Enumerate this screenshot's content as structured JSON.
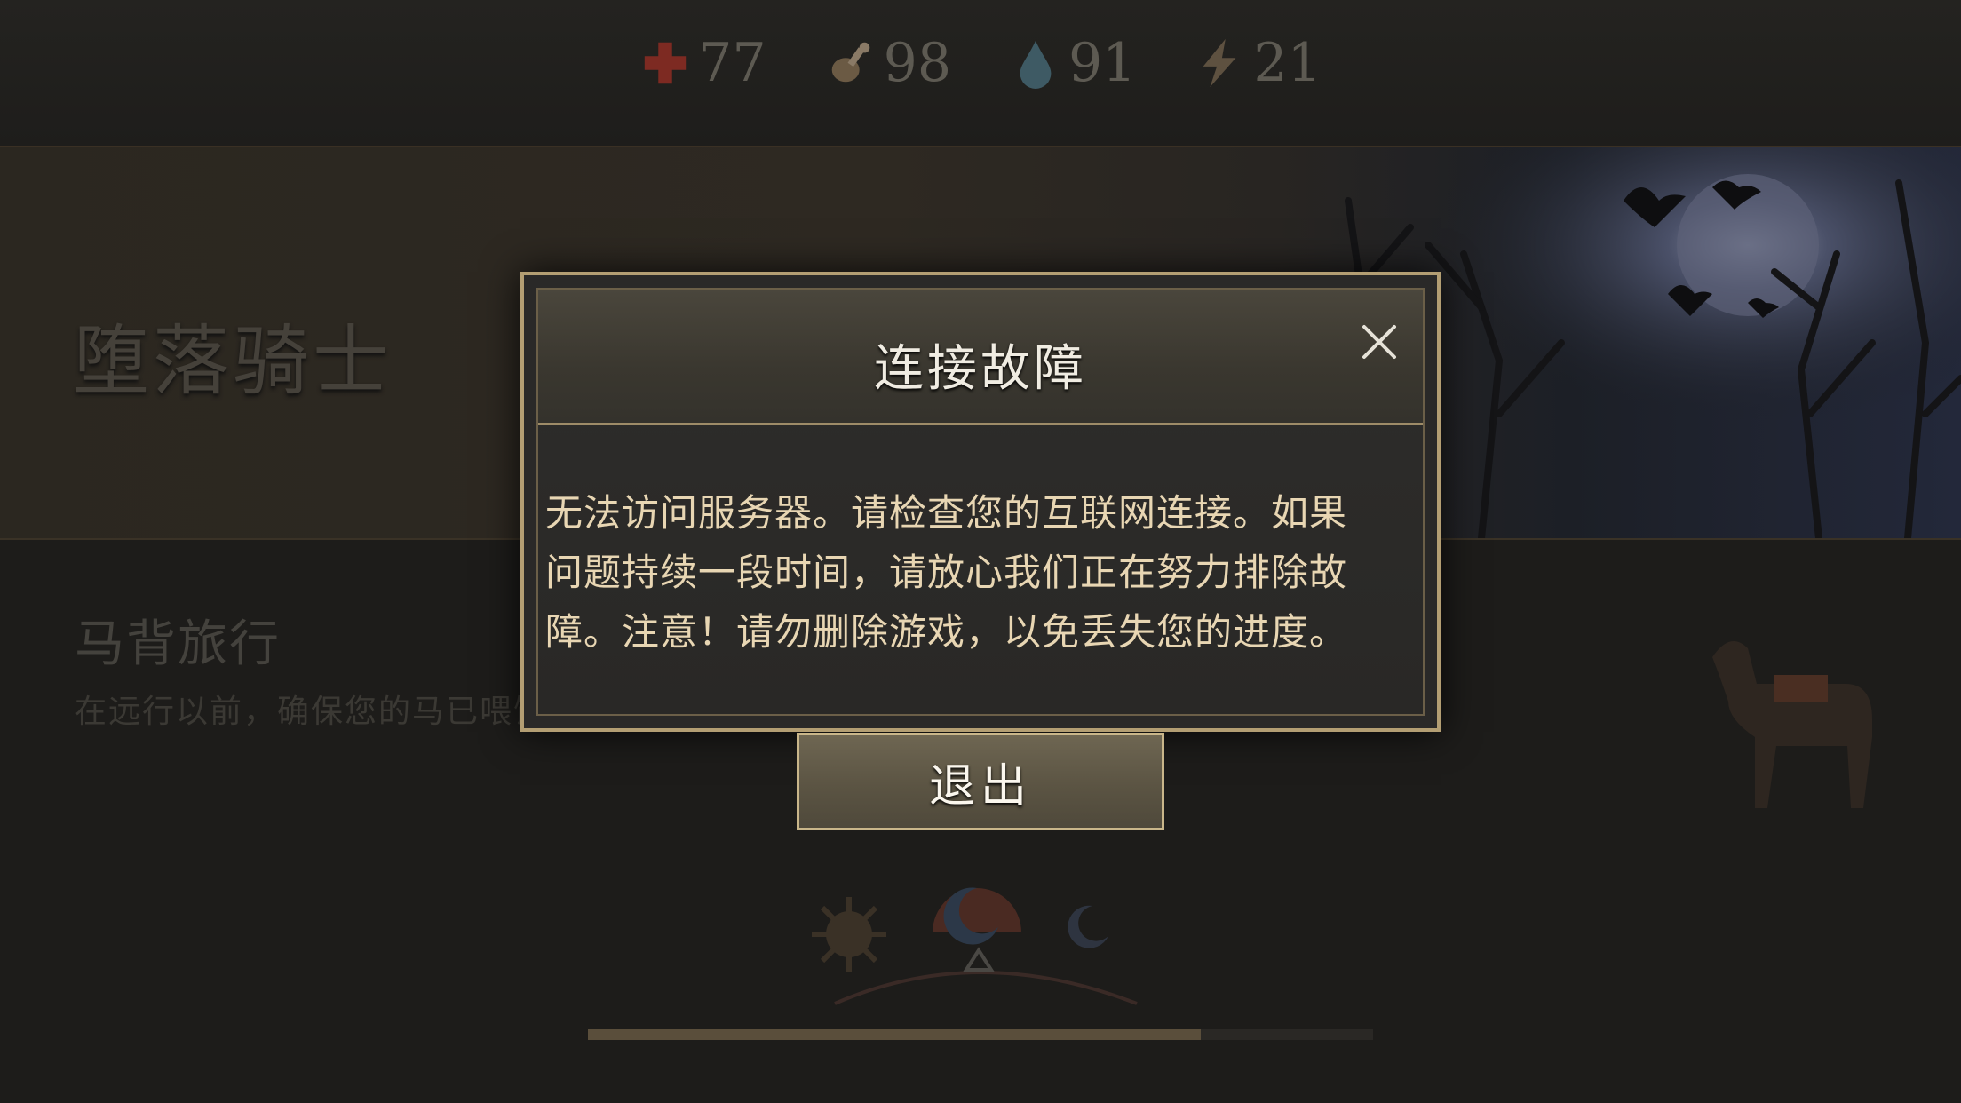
{
  "stats": [
    {
      "icon": "health-cross-icon",
      "value": "77",
      "color": "#8a2a22"
    },
    {
      "icon": "food-meat-icon",
      "value": "98",
      "color": "#6a5a44"
    },
    {
      "icon": "water-drop-icon",
      "value": "91",
      "color": "#4d6a78"
    },
    {
      "icon": "energy-bolt-icon",
      "value": "21",
      "color": "#6a5a44"
    }
  ],
  "banner": {
    "title": "堕落骑士"
  },
  "activity": {
    "title": "马背旅行",
    "description": "在远行以前，确保您的马已喂饱。"
  },
  "progress": {
    "fraction": 0.78
  },
  "modal": {
    "title": "连接故障",
    "body_lines": [
      "无法访问服务器。请检查您的互联网连接。如果",
      "问题持续一段时间，请放心我们正在努力排除故",
      "障。注意！请勿删除游戏，以免丢失您的进度。"
    ],
    "exit_label": "退出"
  },
  "colors": {
    "accent_gold": "#b39e73",
    "body_text": "#e8d6b3"
  }
}
